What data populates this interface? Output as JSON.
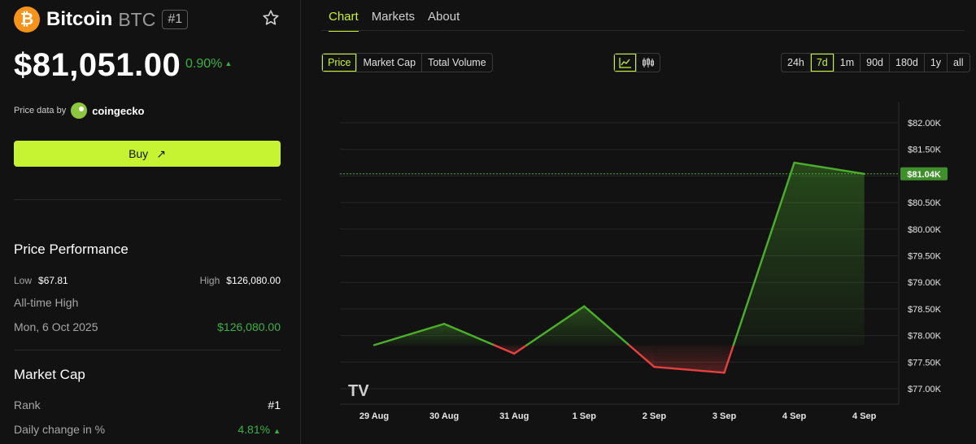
{
  "coin": {
    "logo_glyph": "₿",
    "name": "Bitcoin",
    "symbol": "BTC",
    "rank_badge": "#1",
    "price": "$81,051.00",
    "change": "0.90%",
    "change_arrow": "▲",
    "price_data_by": "Price data by",
    "provider": "coingecko",
    "accent": "#c6f432",
    "positive": "#3bb143",
    "brand": "#f7931a"
  },
  "buy_button": {
    "label": "Buy",
    "arrow": "↗"
  },
  "performance": {
    "title": "Price Performance",
    "low_label": "Low",
    "low_value": "$67.81",
    "high_label": "High",
    "high_value": "$126,080.00",
    "ath_label": "All-time High",
    "ath_date": "Mon, 6 Oct 2025",
    "ath_value": "$126,080.00"
  },
  "market_cap": {
    "title": "Market Cap",
    "rank_label": "Rank",
    "rank_value": "#1",
    "daily_label": "Daily change in %",
    "daily_value": "4.81%",
    "daily_arrow": "▲"
  },
  "tabs": [
    {
      "label": "Chart",
      "active": true
    },
    {
      "label": "Markets",
      "active": false
    },
    {
      "label": "About",
      "active": false
    }
  ],
  "metric_buttons": [
    {
      "label": "Price",
      "active": true
    },
    {
      "label": "Market Cap",
      "active": false
    },
    {
      "label": "Total Volume",
      "active": false
    }
  ],
  "chart_type_icons": [
    {
      "name": "line-chart-icon",
      "active": true
    },
    {
      "name": "candlestick-icon",
      "active": false
    }
  ],
  "range_buttons": [
    {
      "label": "24h",
      "active": false
    },
    {
      "label": "7d",
      "active": true
    },
    {
      "label": "1m",
      "active": false
    },
    {
      "label": "90d",
      "active": false
    },
    {
      "label": "180d",
      "active": false
    },
    {
      "label": "1y",
      "active": false
    },
    {
      "label": "all",
      "active": false
    }
  ],
  "chart_data": {
    "type": "line",
    "x": [
      "29 Aug",
      "30 Aug",
      "31 Aug",
      "1 Sep",
      "2 Sep",
      "3 Sep",
      "4 Sep",
      "4 Sep"
    ],
    "series": [
      {
        "values": [
          77.82,
          78.22,
          77.66,
          78.55,
          77.41,
          77.3,
          81.25,
          81.04
        ]
      }
    ],
    "y_ticks": [
      "$82.00K",
      "$81.50K",
      "$81.00K",
      "$80.50K",
      "$80.00K",
      "$79.50K",
      "$79.00K",
      "$78.50K",
      "$78.00K",
      "$77.50K",
      "$77.00K"
    ],
    "ylim": [
      77.0,
      82.0
    ],
    "baseline": 77.82,
    "current_label": "$81.04K",
    "current_value": 81.04,
    "up_color": "#4caf2b",
    "down_color": "#e5413f",
    "watermark": "TV",
    "grid": true
  }
}
